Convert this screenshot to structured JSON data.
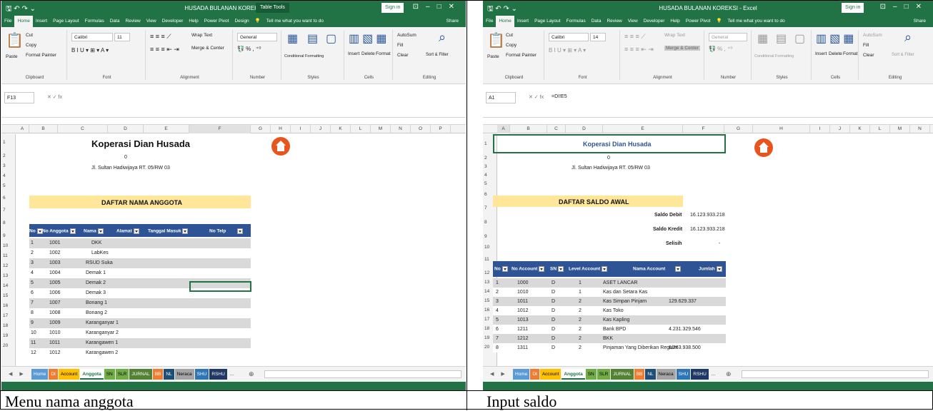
{
  "captions": {
    "left": "Menu nama anggota",
    "right": "Input saldo"
  },
  "left": {
    "qat": "🖫 ↶ ↷ ⌄",
    "doc_title": "HUSADA BULANAN KOREKSI - Excel",
    "table_tools": "Table Tools",
    "signin": "Sign in",
    "ribbon_tabs": [
      "File",
      "Home",
      "Insert",
      "Page Layout",
      "Formulas",
      "Data",
      "Review",
      "View",
      "Developer",
      "Help",
      "Power Pivot",
      "Design"
    ],
    "tell_me": "Tell me what you want to do",
    "share": "Share",
    "clipboard": {
      "cut": "Cut",
      "copy": "Copy",
      "paste": "Paste",
      "format_painter": "Format Painter",
      "label": "Clipboard"
    },
    "font": {
      "name": "Calibri",
      "size": "11",
      "label": "Font"
    },
    "alignment": {
      "wrap": "Wrap Text",
      "merge": "Merge & Center",
      "label": "Alignment"
    },
    "number": {
      "format": "General",
      "label": "Number"
    },
    "styles": {
      "cond": "Conditional Formatting",
      "table": "Format as Table",
      "cell": "Cell Styles",
      "label": "Styles"
    },
    "cells": {
      "insert": "Insert",
      "delete": "Delete",
      "format": "Format",
      "label": "Cells"
    },
    "editing": {
      "autosum": "AutoSum",
      "fill": "Fill",
      "clear": "Clear",
      "sort": "Sort & Filter",
      "find": "Find & Select",
      "label": "Editing"
    },
    "name_box": "F13",
    "formula": "",
    "columns": [
      "A",
      "B",
      "C",
      "D",
      "E",
      "F",
      "G",
      "H",
      "I",
      "J",
      "K",
      "L",
      "M",
      "N",
      "O",
      "P"
    ],
    "company": "Koperasi Dian Husada",
    "zero": "0",
    "address": "Jl. Sultan Hadiwijaya RT. 05/RW 03",
    "banner": "DAFTAR NAMA ANGGOTA",
    "headers": [
      "No",
      "No Anggota",
      "Nama",
      "Alamat",
      "Tanggal Masuk",
      "No Telp"
    ],
    "rows": [
      [
        "1",
        "1001",
        "DKK"
      ],
      [
        "2",
        "1002",
        "LabKes"
      ],
      [
        "3",
        "1003",
        "RSUD Suka"
      ],
      [
        "4",
        "1004",
        "Demak 1"
      ],
      [
        "5",
        "1005",
        "Demak 2"
      ],
      [
        "6",
        "1006",
        "Demak 3"
      ],
      [
        "7",
        "1007",
        "Bonang 1"
      ],
      [
        "8",
        "1008",
        "Bonang 2"
      ],
      [
        "9",
        "1009",
        "Karanganyar 1"
      ],
      [
        "10",
        "1010",
        "Karanganyar 2"
      ],
      [
        "11",
        "1011",
        "Karangawen 1"
      ],
      [
        "12",
        "1012",
        "Karangawen 2"
      ]
    ],
    "sheet_tabs": [
      "Home",
      "DI",
      "Account",
      "Anggota",
      "SN",
      "SLR",
      "JURNAL",
      "BB",
      "NL",
      "Neraca",
      "SHU",
      "RSHU",
      "..."
    ]
  },
  "right": {
    "qat": "🖫 ↶ ↷ ⌄",
    "doc_title": "HUSADA BULANAN KOREKSI - Excel",
    "signin": "Sign in",
    "ribbon_tabs": [
      "File",
      "Home",
      "Insert",
      "Page Layout",
      "Formulas",
      "Data",
      "Review",
      "View",
      "Developer",
      "Help",
      "Power Pivot"
    ],
    "tell_me": "Tell me what you want to do",
    "share": "Share",
    "clipboard": {
      "cut": "Cut",
      "copy": "Copy",
      "paste": "Paste",
      "format_painter": "Format Painter",
      "label": "Clipboard"
    },
    "font": {
      "name": "Calibri",
      "size": "14",
      "label": "Font"
    },
    "alignment": {
      "wrap": "Wrap Text",
      "merge": "Merge & Center",
      "label": "Alignment"
    },
    "number": {
      "format": "General",
      "label": "Number"
    },
    "styles": {
      "cond": "Conditional Formatting",
      "table": "Format as Table",
      "cell": "Cell Styles",
      "label": "Styles"
    },
    "cells": {
      "insert": "Insert",
      "delete": "Delete",
      "format": "Format",
      "label": "Cells"
    },
    "editing": {
      "autosum": "AutoSum",
      "fill": "Fill",
      "clear": "Clear",
      "sort": "Sort & Filter",
      "find": "Find & Select",
      "label": "Editing"
    },
    "name_box": "A1",
    "formula": "=DI!E5",
    "columns": [
      "A",
      "B",
      "C",
      "D",
      "E",
      "F",
      "G",
      "H",
      "I",
      "J",
      "K",
      "L",
      "M",
      "N"
    ],
    "company": "Koperasi Dian Husada",
    "zero": "0",
    "address": "Jl. Sultan Hadiwijaya RT. 05/RW 03",
    "banner": "DAFTAR SALDO AWAL",
    "saldo_debit_label": "Saldo Debit",
    "saldo_debit": "16.123.933.218",
    "saldo_kredit_label": "Saldo Kredit",
    "saldo_kredit": "16.123.933.218",
    "selisih_label": "Selisih",
    "selisih": "-",
    "headers": [
      "No",
      "No Account",
      "SN",
      "Level Account",
      "Nama Account",
      "Jumlah"
    ],
    "rows": [
      [
        "1",
        "1000",
        "D",
        "1",
        "ASET LANCAR",
        ""
      ],
      [
        "2",
        "1010",
        "D",
        "1",
        "Kas dan Setara Kas",
        ""
      ],
      [
        "3",
        "1011",
        "D",
        "2",
        "Kas Simpan Pinjam",
        "129.629.337"
      ],
      [
        "4",
        "1012",
        "D",
        "2",
        "Kas Toko",
        ""
      ],
      [
        "5",
        "1013",
        "D",
        "2",
        "Kas Kapling",
        ""
      ],
      [
        "6",
        "1211",
        "D",
        "2",
        "Bank BPD",
        "4.231.329.546"
      ],
      [
        "7",
        "1212",
        "D",
        "2",
        "BKK",
        ""
      ],
      [
        "8",
        "1311",
        "D",
        "2",
        "Pinjaman Yang Diberikan Reguler",
        "8.263.938.500"
      ]
    ],
    "sheet_tabs": [
      "Home",
      "DI",
      "Account",
      "Anggota",
      "SN",
      "SLR",
      "JURNAL",
      "BB",
      "NL",
      "Neraca",
      "SHU",
      "RSHU",
      "..."
    ]
  }
}
